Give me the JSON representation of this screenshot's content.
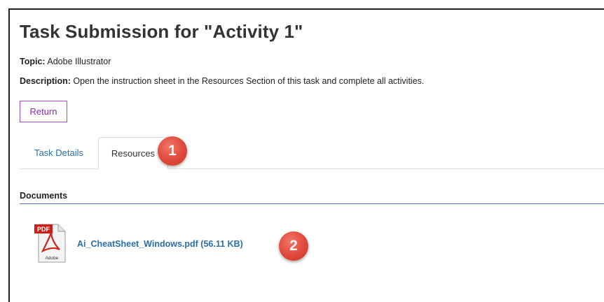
{
  "page": {
    "title": "Task Submission for \"Activity 1\"",
    "topic_label": "Topic:",
    "topic_value": "Adobe Illustrator",
    "description_label": "Description:",
    "description_value": "Open the instruction sheet in the Resources Section of this task and complete all activities.",
    "return_label": "Return"
  },
  "tabs": [
    {
      "label": "Task Details",
      "active": false
    },
    {
      "label": "Resources",
      "active": true
    }
  ],
  "documents": {
    "section_title": "Documents",
    "items": [
      {
        "icon": "pdf-file-icon",
        "name": "Ai_CheatSheet_Windows.pdf (56.11 KB)",
        "icon_tag": "PDF",
        "icon_brand": "Adobe"
      }
    ]
  },
  "annotations": [
    {
      "number": "1"
    },
    {
      "number": "2"
    }
  ],
  "colors": {
    "accent_purple": "#8a2cb5",
    "link_blue": "#2a6ea6",
    "badge_red": "#e0483a",
    "section_rule": "#4a78b8"
  }
}
